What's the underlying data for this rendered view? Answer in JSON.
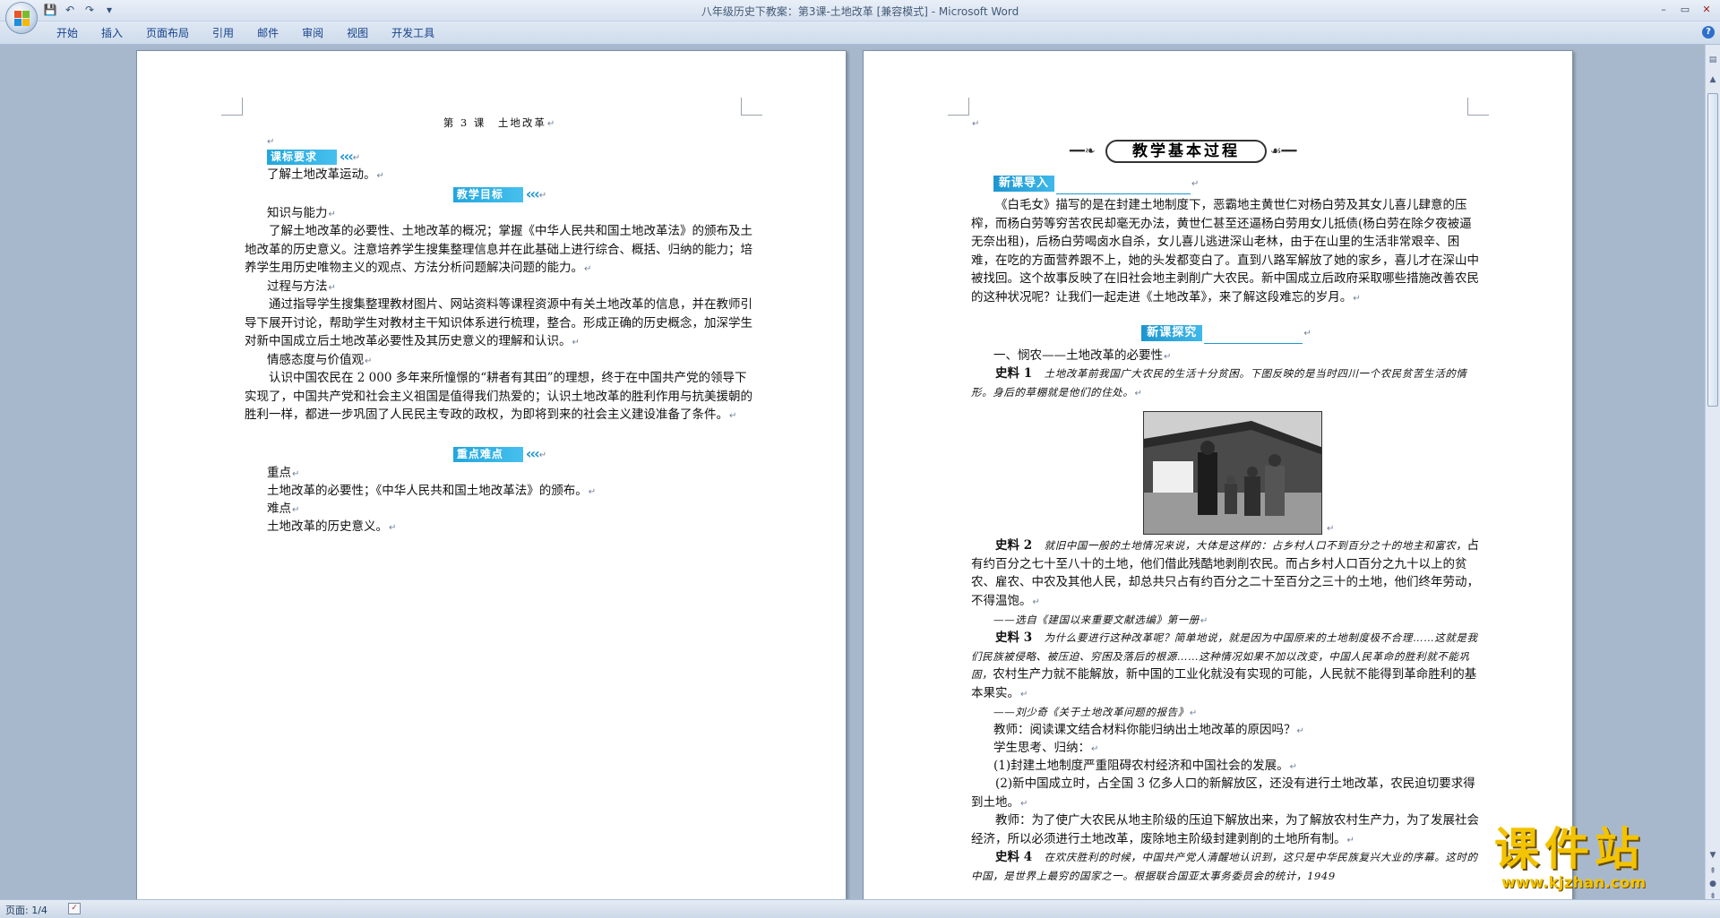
{
  "window": {
    "title": "八年级历史下教案：第3课-土地改革 [兼容模式] - Microsoft Word",
    "controls": [
      "–",
      "▭",
      "✕"
    ]
  },
  "qat": [
    "💾",
    "↶",
    "↷",
    "▾"
  ],
  "ribbon": {
    "tabs": [
      "开始",
      "插入",
      "页面布局",
      "引用",
      "邮件",
      "审阅",
      "视图",
      "开发工具"
    ]
  },
  "left_page": {
    "lesson_title": "第 3 课　土地改革",
    "banner_requirements": "课标要求",
    "requirement_text": "了解土地改革运动。",
    "banner_goals": "教学目标",
    "h_knowledge": "知识与能力",
    "p_knowledge": "了解土地改革的必要性、土地改革的概况；掌握《中华人民共和国土地改革法》的颁布及土地改革的历史意义。注意培养学生搜集整理信息并在此基础上进行综合、概括、归纳的能力；培养学生用历史唯物主义的观点、方法分析问题解决问题的能力。",
    "h_process": "过程与方法",
    "p_process": "通过指导学生搜集整理教材图片、网站资料等课程资源中有关土地改革的信息，并在教师引导下展开讨论，帮助学生对教材主干知识体系进行梳理，整合。形成正确的历史概念，加深学生对新中国成立后土地改革必要性及其历史意义的理解和认识。",
    "h_emotion": "情感态度与价值观",
    "p_emotion": "认识中国农民在 2 000 多年来所憧憬的“耕者有其田”的理想，终于在中国共产党的领导下实现了，中国共产党和社会主义祖国是值得我们热爱的；认识土地改革的胜利作用与抗美援朝的胜利一样，都进一步巩固了人民民主专政的政权，为即将到来的社会主义建设准备了条件。",
    "banner_key": "重点难点",
    "h_key": "重点",
    "p_key": "土地改革的必要性；《中华人民共和国土地改革法》的颁布。",
    "h_difficult": "难点",
    "p_difficult": "土地改革的历史意义。"
  },
  "right_page": {
    "main_title": "教学基本过程",
    "banner_intro": "新课导入",
    "p_intro": "《白毛女》描写的是在封建土地制度下，恶霸地主黄世仁对杨白劳及其女儿喜儿肆意的压榨，而杨白劳等穷苦农民却毫无办法，黄世仁甚至还逼杨白劳用女儿抵债(杨白劳在除夕夜被逼无奈出租)，后杨白劳喝卤水自杀，女儿喜儿逃进深山老林，由于在山里的生活非常艰辛、困难，在吃的方面营养跟不上，她的头发都变白了。直到八路军解放了她的家乡，喜儿才在深山中被找回。这个故事反映了在旧社会地主剥削广大农民。新中国成立后政府采取哪些措施改善农民的这种状况呢？让我们一起走进《土地改革》，来了解这段难忘的岁月。",
    "banner_explore": "新课探究",
    "h_section1": "一、悯农——土地改革的必要性",
    "m1_label": "史料 1",
    "m1_text": "土地改革前我国广大农民的生活十分贫困。下图反映的是当时四川一个农民贫苦生活的情形。身后的草棚就是他们的住处。",
    "m2_label": "史料 2",
    "m2_text_a": "就旧中国一般的土地情况来说，大体是这样的：占乡村人口不到百分之十的地主和富农，",
    "m2_text_b": "占有约百分之七十至八十的土地，他们借此残酷地剥削农民。而占乡村人口百分之九十以上的贫农、雇农、中农及其他人民，却总共只占有约百分之二十至百分之三十的土地，他们终年劳动，不得温饱。",
    "m2_source": "——选自《建国以来重要文献选编》第一册",
    "m3_label": "史料 3",
    "m3_text_a": "为什么要进行这种改革呢？简单地说，就是因为中国原来的土地制度极不合理……这就是我们民族被侵略、被压迫、穷困及落后的根源……这种情况如果不加以改变，中国人民革命的胜利就不能巩固，",
    "m3_text_b": "农村生产力就不能解放，新中国的工业化就没有实现的可能，人民就不能得到革命胜利的基本果实。",
    "m3_source": "——刘少奇《关于土地改革问题的报告》",
    "q_teacher": "教师：阅读课文结合材料你能归纳出土地改革的原因吗？",
    "q_student": "学生思考、归纳：",
    "a1": "(1)封建土地制度严重阻碍农村经济和中国社会的发展。",
    "a2": "(2)新中国成立时，占全国 3 亿多人口的新解放区，还没有进行土地改革，农民迫切要求得到土地。",
    "teacher_sum": "教师：为了使广大农民从地主阶级的压迫下解放出来，为了解放农村生产力，为了发展社会经济，所以必须进行土地改革，废除地主阶级封建剥削的土地所有制。",
    "m4_label": "史料 4",
    "m4_text": "在欢庆胜利的时候，中国共产党人清醒地认识到，这只是中华民族复兴大业的序幕。这时的中国，是世界上最穷的国家之一。根据联合国亚太事务委员会的统计，1949"
  },
  "statusbar": {
    "page": "页面: 1/4"
  },
  "watermark": {
    "text": "课件站",
    "url": "www.kjzhan.com"
  }
}
